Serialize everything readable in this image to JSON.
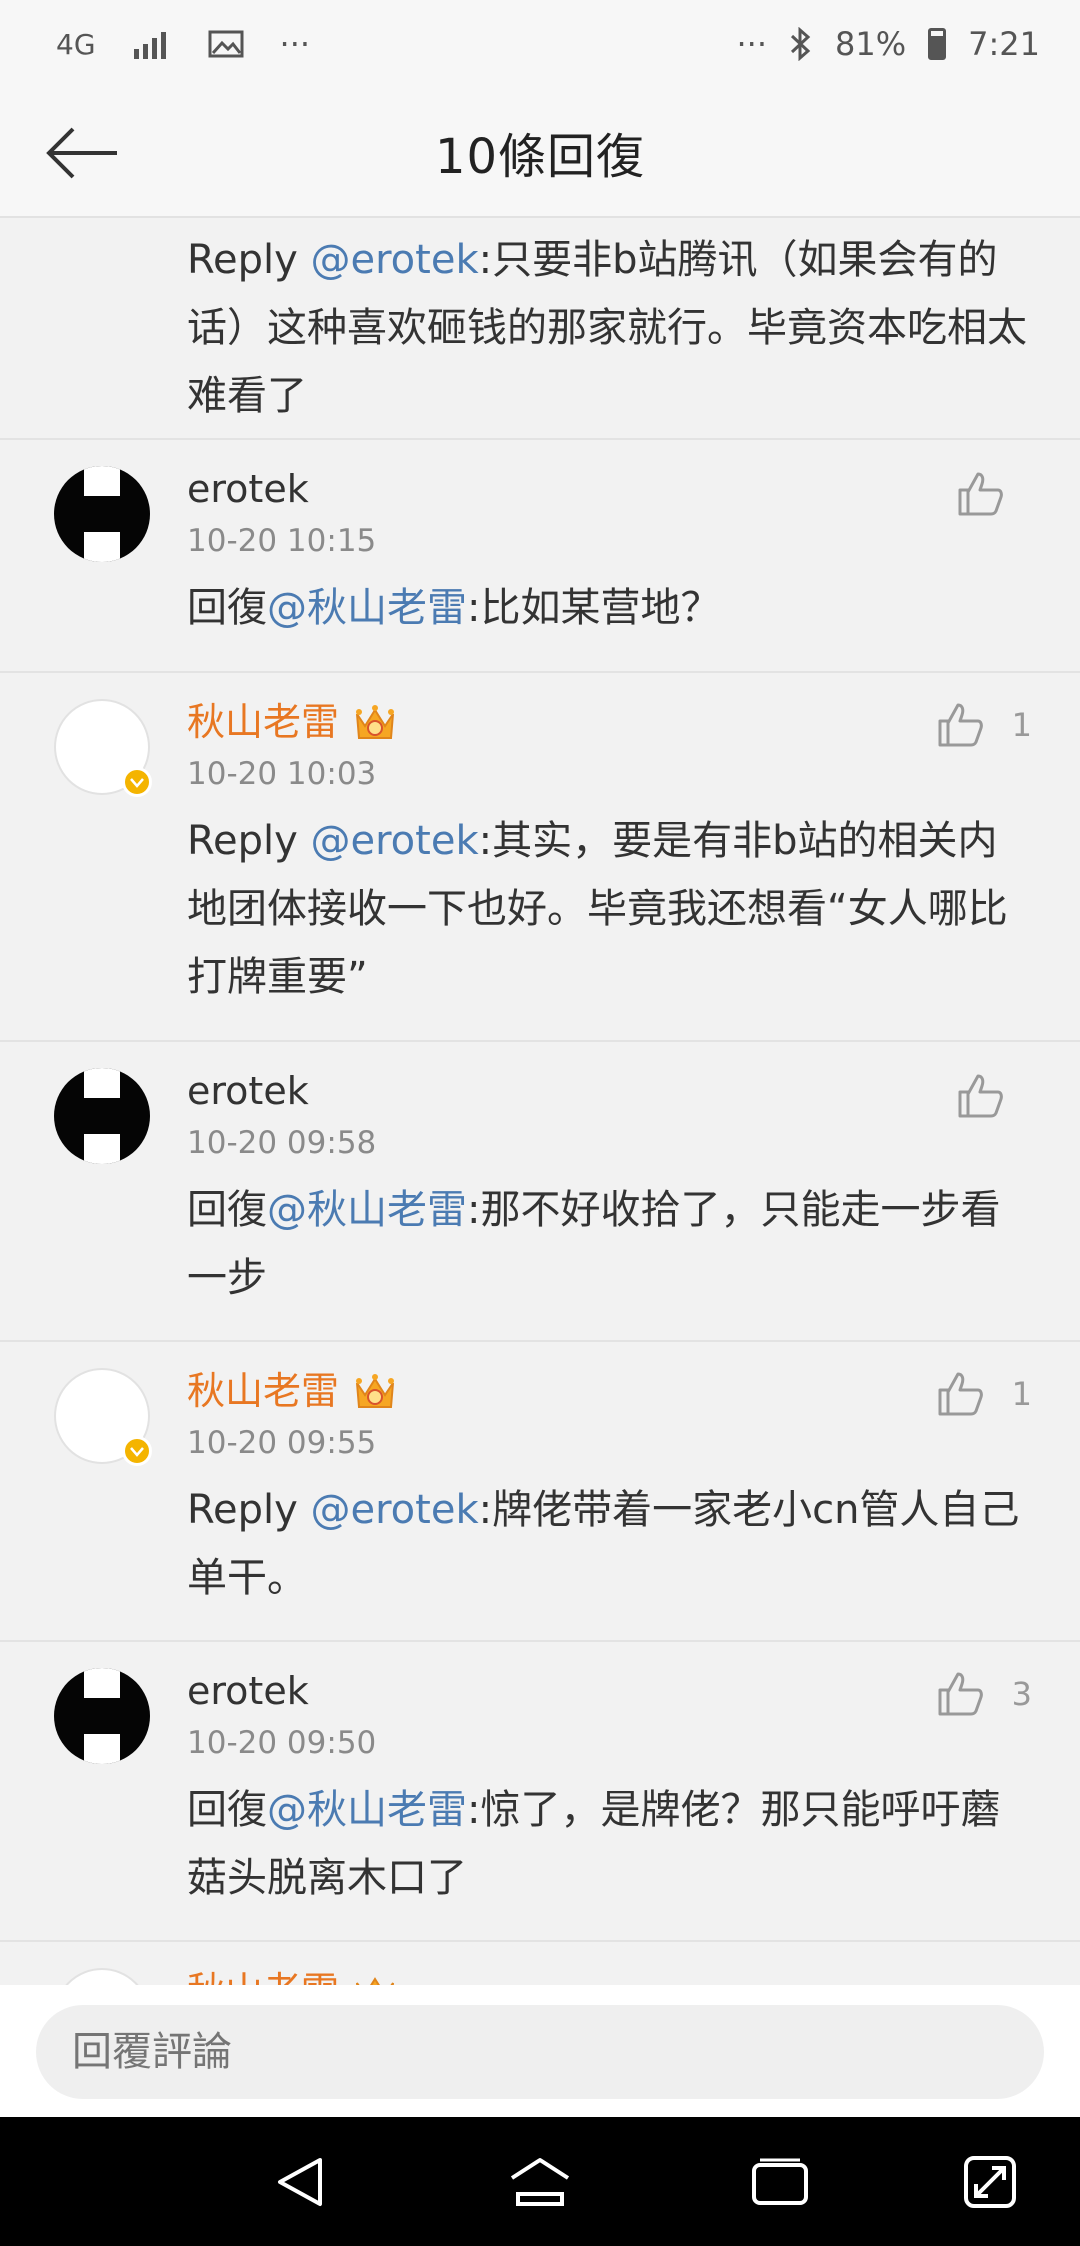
{
  "status_bar": {
    "network": "4G",
    "more": "···",
    "battery": "81%",
    "time": "7:21"
  },
  "header": {
    "title": "10條回復"
  },
  "comments": [
    {
      "prefix": "Reply ",
      "mention": "@erotek",
      "text": ":只要非b站腾讯（如果会有的话）这种喜欢砸钱的那家就行。毕竟资本吃相太难看了"
    },
    {
      "name": "erotek",
      "time": "10-20 10:15",
      "likes": "",
      "prefix": "回復",
      "mention": "@秋山老雷",
      "text": ":比如某营地？"
    },
    {
      "name": "秋山老雷",
      "time": "10-20 10:03",
      "likes": "1",
      "prefix": "Reply ",
      "mention": "@erotek",
      "text": ":其实，要是有非b站的相关内地团体接收一下也好。毕竟我还想看“女人哪比打牌重要”"
    },
    {
      "name": "erotek",
      "time": "10-20 09:58",
      "likes": "",
      "prefix": "回復",
      "mention": "@秋山老雷",
      "text": ":那不好收拾了，只能走一步看一步"
    },
    {
      "name": "秋山老雷",
      "time": "10-20 09:55",
      "likes": "1",
      "prefix": "Reply ",
      "mention": "@erotek",
      "text": ":牌佬带着一家老小cn管人自己单干。"
    },
    {
      "name": "erotek",
      "time": "10-20 09:50",
      "likes": "3",
      "prefix": "回復",
      "mention": "@秋山老雷",
      "text": ":惊了，是牌佬？那只能呼吁蘑菇头脱离木口了"
    },
    {
      "name": "秋山老雷"
    }
  ],
  "reply_bar": {
    "placeholder": "回覆評論"
  },
  "colors": {
    "mention": "#4b7bb2",
    "vip_name": "#e87722",
    "background": "#f2f2f2"
  }
}
